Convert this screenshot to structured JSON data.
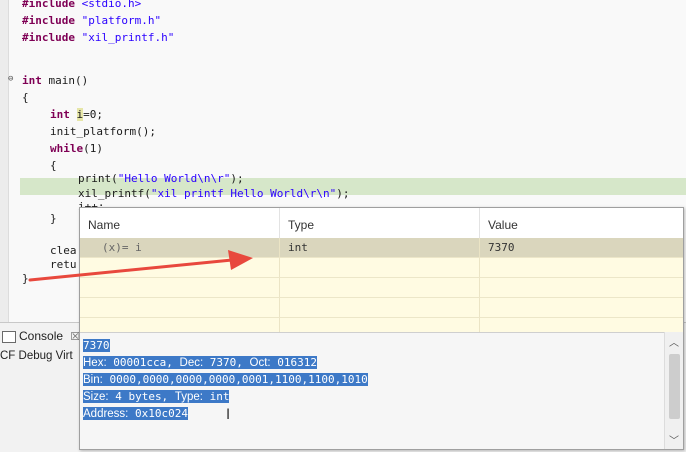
{
  "editor": {
    "lines": [
      "#include <stdio.h>",
      "#include \"platform.h\"",
      "#include \"xil_printf.h\"",
      "int main()",
      "{",
      "int i=0;",
      "init_platform();",
      "while(1)",
      "{",
      "print(\"Hello World\\n\\r\");",
      "xil_printf(\"xil printf Hello World\\r\\n\");",
      "i++;",
      "}",
      "clea",
      "retu",
      "}"
    ]
  },
  "console": {
    "tab_label": "Console",
    "tab_icon": "close-icon",
    "sub_label": "CF Debug Virt"
  },
  "hover": {
    "columns": [
      "Name",
      "Type",
      "Value"
    ],
    "rows": [
      {
        "name": "(x)= i",
        "type": "int",
        "value": "7370"
      }
    ],
    "details": {
      "line1": "7370",
      "line2_hex_label": "Hex:",
      "line2_hex": "00001cca,",
      "line2_dec_label": "Dec:",
      "line2_dec": "7370,",
      "line2_oct_label": "Oct:",
      "line2_oct": "016312",
      "line3_label": "Bin:",
      "line3": "0000,0000,0000,0000,0001,1100,1100,1010",
      "line4_size_label": "Size:",
      "line4_size": "4 bytes,",
      "line4_type_label": "Type:",
      "line4_type": "int",
      "line5_label": "Address:",
      "line5": "0x10c024"
    }
  },
  "colors": {
    "accent_arrow": "#e8483d",
    "selection": "#3d79c7",
    "current_line": "#d6e7c9"
  }
}
